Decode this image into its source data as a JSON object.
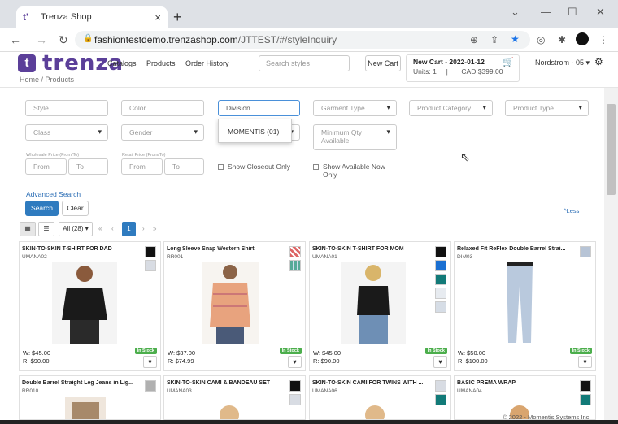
{
  "browser": {
    "tab_title": "Trenza Shop",
    "tab_close": "×",
    "new_tab": "+",
    "url_host": "fashiontestdemo.trenzashop.com",
    "url_path": "/JTTEST/#/styleInquiry"
  },
  "header": {
    "logo_letter": "t",
    "logo_text": "trenza",
    "breadcrumb": "Home  /  Products",
    "nav": [
      "Catalogs",
      "Products",
      "Order History"
    ],
    "search_placeholder": "Search styles",
    "new_cart_label": "New Cart",
    "cart_title": "New Cart - 2022-01-12",
    "cart_units": "Units: 1",
    "cart_sep": "|",
    "cart_total": "CAD $399.00",
    "store": "Nordstrom - 05 ▾"
  },
  "filters": {
    "style": "Style",
    "color": "Color",
    "division": "Division",
    "garment_type": "Garment Type",
    "product_category": "Product Category",
    "product_type": "Product Type",
    "class": "Class",
    "gender": "Gender",
    "min_qty": "Minimum Qty Available",
    "wholesale_caption": "Wholesale Price (From/To)",
    "retail_caption": "Retail Price (From/To)",
    "from": "From",
    "to": "To",
    "closeout": "Show Closeout Only",
    "available_now_1": "Show Available Now",
    "available_now_2": "Only",
    "advanced": "Advanced Search",
    "search_btn": "Search",
    "clear_btn": "Clear",
    "less": "^Less",
    "division_option": "MOMENTIS (01)"
  },
  "pagination": {
    "all_select": "All (28) ▾",
    "first": "«",
    "prev": "‹",
    "current": "1",
    "next": "›",
    "last": "»"
  },
  "products": [
    {
      "name": "SKIN-TO-SKIN T-SHIRT FOR DAD",
      "sku": "UMANA02",
      "w": "W: $45.00",
      "r": "R: $90.00",
      "stock": "In Stock"
    },
    {
      "name": "Long Sleeve Snap Western Shirt",
      "sku": "RR001",
      "w": "W: $37.00",
      "r": "R: $74.99",
      "stock": "In Stock"
    },
    {
      "name": "SKIN-TO-SKIN T-SHIRT FOR MOM",
      "sku": "UMANA01",
      "w": "W: $45.00",
      "r": "R: $90.00",
      "stock": "In Stock"
    },
    {
      "name": "Relaxed Fit ReFlex Double Barrel Strai...",
      "sku": "DIM03",
      "w": "W: $50.00",
      "r": "R: $100.00",
      "stock": "In Stock"
    },
    {
      "name": "Double Barrel Straight Leg Jeans in Lig...",
      "sku": "RR010"
    },
    {
      "name": "SKIN-TO-SKIN CAMI & BANDEAU SET",
      "sku": "UMANA03"
    },
    {
      "name": "SKIN-TO-SKIN CAMI FOR TWINS WITH ...",
      "sku": "UMANA06"
    },
    {
      "name": "BASIC PREMA WRAP",
      "sku": "UMANA04"
    }
  ],
  "footer": "© 2022 - Momentis Systems Inc.",
  "colors": {
    "brand": "#5b3f99",
    "primary": "#2f7bbf",
    "in_stock": "#4cae4c"
  }
}
